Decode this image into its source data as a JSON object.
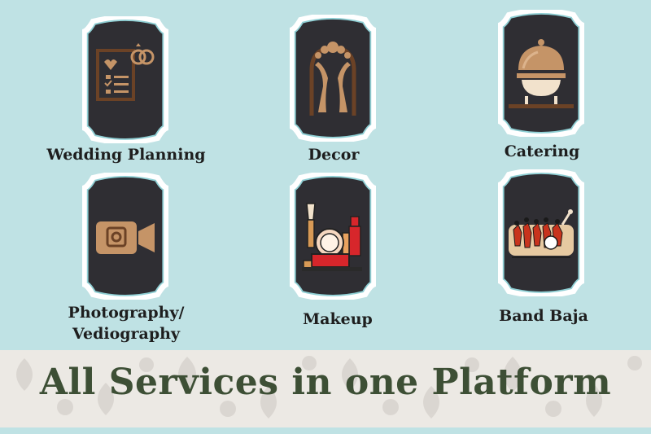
{
  "services": [
    {
      "label": "Wedding Planning",
      "icon": "checklist-rings-icon"
    },
    {
      "label": "Decor",
      "icon": "floral-arch-icon"
    },
    {
      "label": "Catering",
      "icon": "food-cloche-icon"
    },
    {
      "label": "Photography/",
      "label2": "Vediography",
      "icon": "video-camera-icon"
    },
    {
      "label": "Makeup",
      "icon": "makeup-kit-icon"
    },
    {
      "label": "Band Baja",
      "icon": "band-baja-icon"
    }
  ],
  "banner": {
    "title": "All Services in one Platform"
  },
  "colors": {
    "background": "#bfe2e4",
    "card": "#2f2e33",
    "icon_gold": "#c59467",
    "icon_brown": "#6b4226",
    "title": "#3d4f35"
  }
}
